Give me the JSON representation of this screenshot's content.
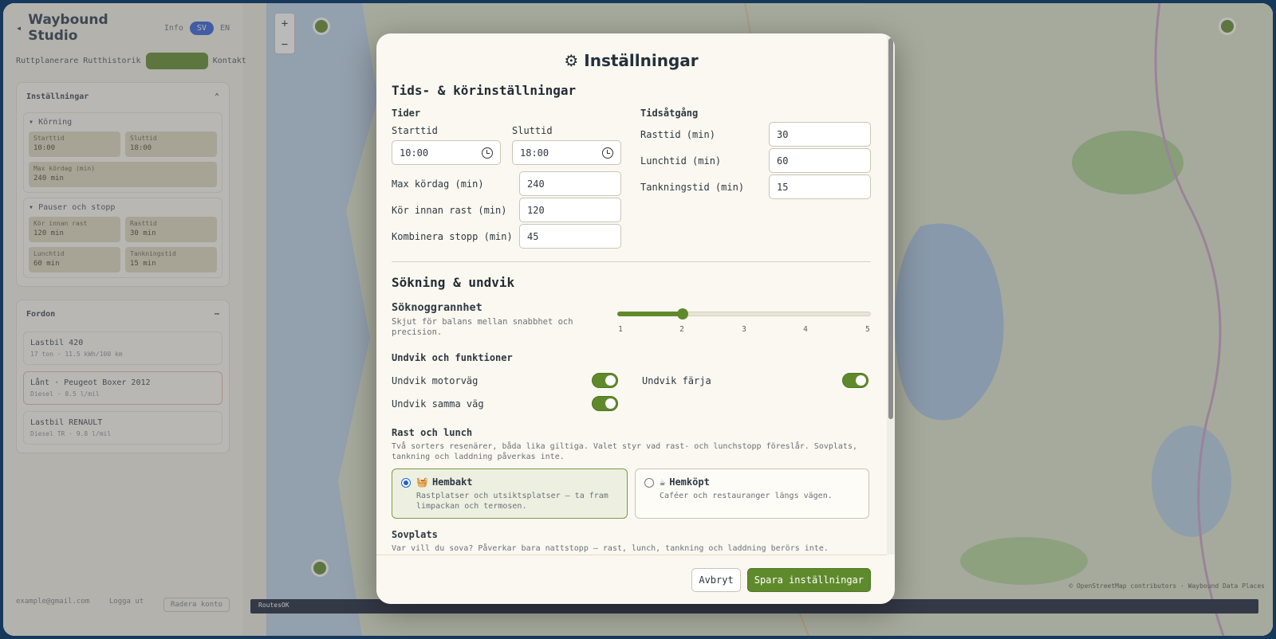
{
  "app": {
    "brand_title": "Waybound Studio",
    "brand_link": "Info",
    "lang_active": "SV",
    "lang_alt": "EN",
    "nav_tabs": [
      "Ruttplanerare",
      "Rutthistorik",
      "Planera",
      "Kontakt"
    ],
    "settings_panel_title": "Inställningar",
    "driving_section": "Körning",
    "driving_fields": [
      {
        "label": "Starttid",
        "value": "10:00"
      },
      {
        "label": "Sluttid",
        "value": "18:00"
      },
      {
        "label": "Max kördag (min)",
        "value": "240 min"
      }
    ],
    "pause_section": "Pauser och stopp",
    "pause_fields": [
      {
        "label": "Kör innan rast",
        "value": "120 min"
      },
      {
        "label": "Rasttid",
        "value": "30 min"
      },
      {
        "label": "Lunchtid",
        "value": "60 min"
      },
      {
        "label": "Tankningstid",
        "value": "15 min"
      }
    ],
    "vehicles_title": "Fordon",
    "vehicles": [
      {
        "name": "Lastbil 420",
        "meta": "17 ton · 11.5 kWh/100 km"
      },
      {
        "name": "Lånt · Peugeot Boxer 2012",
        "meta": "Diesel · 8.5 l/mil"
      },
      {
        "name": "Lastbil RENAULT",
        "meta": "Diesel TR · 9.8 l/mil"
      }
    ],
    "user_email": "example@gmail.com",
    "logout_label": "Logga ut",
    "delete_label": "Radera konto",
    "map_attribution": "© OpenStreetMap contributors · Waybound Data Places",
    "bottom_bar": "RoutesOK",
    "zoom_in": "+",
    "zoom_out": "−"
  },
  "modal": {
    "title_icon": "⚙",
    "title": "Inställningar",
    "times_section": {
      "title": "Tids- & körinställningar",
      "times_heading": "Tider",
      "start_label": "Starttid",
      "start_value": "10:00",
      "end_label": "Sluttid",
      "end_value": "18:00",
      "max_day_label": "Max kördag (min)",
      "max_day_value": "240",
      "drive_before_break_label": "Kör innan rast (min)",
      "drive_before_break_value": "120",
      "combine_stops_label": "Kombinera stopp (min)",
      "combine_stops_value": "45",
      "durations_heading": "Tidsåtgång",
      "break_label": "Rasttid (min)",
      "break_value": "30",
      "lunch_label": "Lunchtid (min)",
      "lunch_value": "60",
      "refuel_label": "Tankningstid (min)",
      "refuel_value": "15"
    },
    "search_section": {
      "title": "Sökning & undvik",
      "precision_label": "Söknoggrannhet",
      "precision_desc": "Skjut för balans mellan snabbhet och precision.",
      "precision_value": 2,
      "precision_ticks": [
        "1",
        "2",
        "3",
        "4",
        "5"
      ],
      "avoid_heading": "Undvik och funktioner",
      "avoid_motorway": "Undvik motorväg",
      "avoid_ferry": "Undvik färja",
      "avoid_same_road": "Undvik samma väg"
    },
    "rest_section": {
      "heading": "Rast och lunch",
      "desc": "Två sorters resenärer, båda lika giltiga. Valet styr vad rast- och lunchstopp föreslår. Sovplats, tankning och laddning påverkas inte.",
      "option_home_icon": "🧺",
      "option_home_title": "Hembakt",
      "option_home_desc": "Rastplatser och utsiktsplatser — ta fram limpackan och termosen.",
      "option_bought_icon": "☕",
      "option_bought_title": "Hemköpt",
      "option_bought_desc": "Caféer och restauranger längs vägen."
    },
    "sleep_section": {
      "heading": "Sovplats",
      "desc": "Var vill du sova? Påverkar bara nattstopp — rast, lunch, tankning och laddning berörs inte."
    },
    "footer": {
      "cancel": "Avbryt",
      "save": "Spara inställningar"
    }
  },
  "colors": {
    "accent": "#5f8a2c",
    "modal_bg": "#faf8f0",
    "radio_selected": "#1a64d8"
  }
}
